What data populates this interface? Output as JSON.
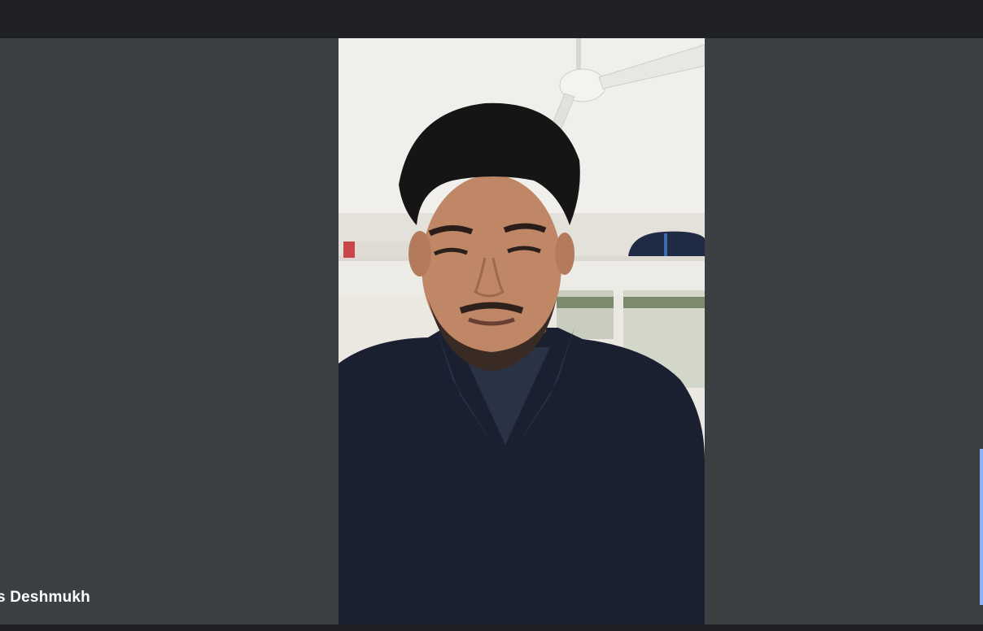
{
  "participant": {
    "name_label": "s Deshmukh",
    "video_description": "participant-camera-feed"
  },
  "colors": {
    "top_bar": "#202124",
    "stage_background": "#3c4043",
    "name_text": "#ffffff",
    "edge_indicator": "#8ab4f8"
  }
}
